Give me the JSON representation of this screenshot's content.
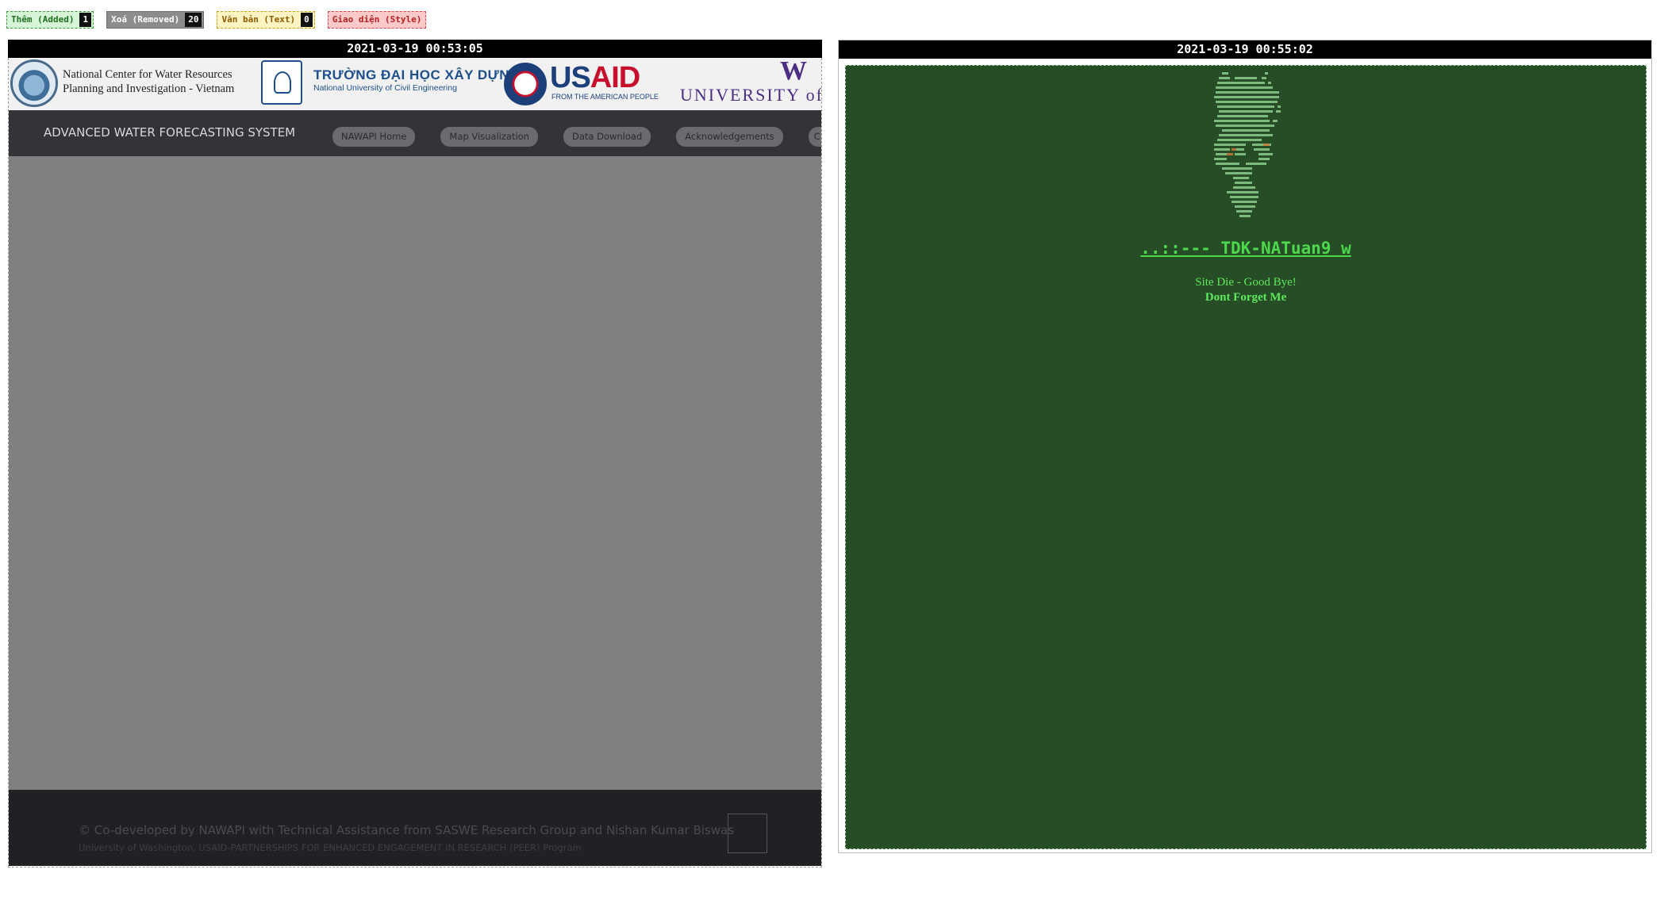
{
  "legend": {
    "added": {
      "label": "Thêm (Added)",
      "count": "1"
    },
    "removed": {
      "label": "Xoá (Removed)",
      "count": "20"
    },
    "text": {
      "label": "Văn bản (Text)",
      "count": "0"
    },
    "style": {
      "label": "Giao diện (Style)"
    }
  },
  "left_panel": {
    "timestamp": "2021-03-19 00:53:05",
    "logos": {
      "nawapi_line1": "National Center for Water Resources",
      "nawapi_line2": "Planning and Investigation - Vietnam",
      "nuce_main": "TRƯỜNG ĐẠI HỌC XÂY DỰNG",
      "nuce_sub": "National University of Civil Engineering",
      "usaid_us": "US",
      "usaid_aid": "AID",
      "usaid_sub": "FROM THE AMERICAN PEOPLE",
      "uw_letter": "W",
      "uw_text": "UNIVERSITY of WA"
    },
    "navbar": {
      "brand": "ADVANCED WATER FORECASTING SYSTEM",
      "buttons": [
        "NAWAPI Home",
        "Map Visualization",
        "Data Download",
        "Acknowledgements",
        "C"
      ]
    },
    "footer": {
      "line1": "© Co-developed by NAWAPI with Technical Assistance from SASWE Research Group and Nishan Kumar Biswas",
      "line2": "University of Washington, USAID-PARTNERSHIPS FOR ENHANCED ENGAGEMENT IN RESEARCH (PEER) Program"
    }
  },
  "right_panel": {
    "timestamp": "2021-03-19 00:55:02",
    "title": "..::--- TDK-NATuan9 w",
    "line1": "Site Die - Good Bye!",
    "line2": "Dont Forget Me"
  },
  "colors": {
    "added": "#3a9a3a",
    "removed": "#8c8c8c",
    "text": "#caa21a",
    "style": "#d84848",
    "defaced_bg": "#264d26",
    "defaced_text": "#4cd94c"
  }
}
